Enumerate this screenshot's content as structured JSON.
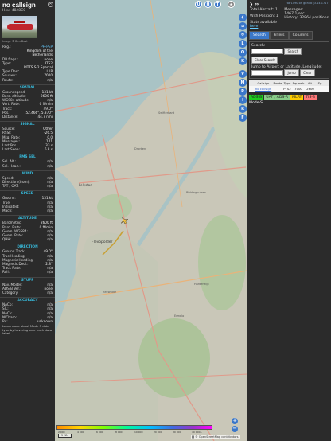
{
  "aircraft": {
    "callsign": "no callsign",
    "hex_label": "Hex:",
    "hex": "4848C0",
    "photo_credit": "Image © Ben Dost",
    "reg_label": "Reg.:",
    "reg": "PH-PEP",
    "country": "Kingdom of the Netherlands",
    "db_flags_label": "DB flags:",
    "db_flags": "none",
    "type_label": "Type:",
    "type": "PTS2",
    "type_full": "PITTS S-2 Special",
    "type_desc_label": "Type Desc.:",
    "type_desc": "L1P",
    "squawk_label": "Squawk:",
    "squawk": "7000",
    "route_label": "Route:",
    "route": "n/a"
  },
  "sections": {
    "spatial": "SPATIAL",
    "signal": "SIGNAL",
    "fms": "FMS SEL",
    "wind": "WIND",
    "speed": "SPEED",
    "altitude": "ALTITUDE",
    "direction": "DIRECTION",
    "stuff": "STUFF",
    "accuracy": "ACCURACY"
  },
  "spatial": [
    {
      "label": "Groundspeed:",
      "value": "131 kt"
    },
    {
      "label": "Baro. altitude:",
      "value": "2600 ft"
    },
    {
      "label": "WGS84 altitude:",
      "value": "n/a"
    },
    {
      "label": "Vert. Rate:",
      "value": "0 ft/min"
    },
    {
      "label": "Track:",
      "value": "49.0°"
    },
    {
      "label": "Pos.:",
      "value": "52.466°, 5.370°"
    },
    {
      "label": "Distance:",
      "value": "44.7 nmi"
    }
  ],
  "signal": [
    {
      "label": "Source:",
      "value": "Other"
    },
    {
      "label": "RSSI:",
      "value": "-26.5"
    },
    {
      "label": "Msg. Rate:",
      "value": "0.0"
    },
    {
      "label": "Messages:",
      "value": "141"
    },
    {
      "label": "Last Pos.:",
      "value": "33 s"
    },
    {
      "label": "Last Seen:",
      "value": "6.8 s"
    }
  ],
  "fms": [
    {
      "label": "Sel. Alt.:",
      "value": "n/a"
    },
    {
      "label": "Sel. Head.:",
      "value": "n/a"
    }
  ],
  "wind": [
    {
      "label": "Speed:",
      "value": "n/a"
    },
    {
      "label": "Direction (from):",
      "value": "n/a"
    },
    {
      "label": "TAT / OAT:",
      "value": "n/a"
    }
  ],
  "speed": [
    {
      "label": "Ground:",
      "value": "131 kt"
    },
    {
      "label": "True:",
      "value": "n/a"
    },
    {
      "label": "Indicated:",
      "value": "n/a"
    },
    {
      "label": "Mach:",
      "value": "n/a"
    }
  ],
  "altitude": [
    {
      "label": "Barometric:",
      "value": "2600 ft"
    },
    {
      "label": "Baro. Rate:",
      "value": "0 ft/min"
    },
    {
      "label": "Geom. WGS84:",
      "value": "n/a"
    },
    {
      "label": "Geom. Rate:",
      "value": "n/a"
    },
    {
      "label": "QNH:",
      "value": "n/a"
    }
  ],
  "direction": [
    {
      "label": "Ground Track:",
      "value": "49.0°"
    },
    {
      "label": "True Heading:",
      "value": "n/a"
    },
    {
      "label": "Magnetic Heading:",
      "value": "n/a"
    },
    {
      "label": "Magnetic Decl.:",
      "value": "2.8°"
    },
    {
      "label": "Track Rate:",
      "value": "n/a"
    },
    {
      "label": "Roll:",
      "value": "n/a"
    }
  ],
  "stuff": [
    {
      "label": "Nav. Modes:",
      "value": "n/a"
    },
    {
      "label": "ADS-B Ver.:",
      "value": "none"
    },
    {
      "label": "Category:",
      "value": "n/a"
    }
  ],
  "accuracy": [
    {
      "label": "NACp:",
      "value": "n/a"
    },
    {
      "label": "SIL:",
      "value": "n/a"
    },
    {
      "label": "NACv:",
      "value": "n/a"
    },
    {
      "label": "NICbaro:",
      "value": "n/a"
    },
    {
      "label": "Rc:",
      "value": "unknown"
    }
  ],
  "footnote": "Learn more about Mode S data type by hovering over each data label.",
  "map": {
    "top_buttons": [
      "U",
      "H",
      "T"
    ],
    "side_buttons": [
      "❮",
      "⌂",
      "↻",
      "L",
      "O",
      "K",
      "V",
      "M",
      "P",
      "I",
      "R",
      "F"
    ],
    "city_labels": [
      "Lelystad",
      "Dronten",
      "Swifterbant",
      "Biddinghuizen",
      "Zeewolde",
      "Ermelo",
      "Harderwijk"
    ],
    "aircraft_label": "Flevopolder",
    "zoom_in": "+",
    "zoom_out": "−",
    "scale_label": "5 NM",
    "altitude_scale": [
      "2 000",
      "4 000",
      "6 000",
      "8 000",
      "10 000",
      "20 000",
      "30 000",
      "40 000+"
    ],
    "attribution": "© OpenStreetMap contributors."
  },
  "right": {
    "version_link": "tar1090 on github (3.14.1717)",
    "total_label": "Total Aircraft:",
    "total": "1",
    "with_pos_label": "With Position:",
    "with_pos": "1",
    "msgs_label": "Messages:",
    "msgs": "1467.1/sec",
    "history_label": "History:",
    "history": "32864 positions",
    "stats_label": "Stats available",
    "stats_link": "here",
    "tabs": [
      "Search",
      "Filters",
      "Columns"
    ],
    "search_label": "Search:",
    "search_button": "Search",
    "clear_button": "Clear Search",
    "jump_label": "Jump to Airport or Latitude, Longitude:",
    "jump_button": "Jump",
    "clear2_button": "Clear",
    "table_headers": [
      "",
      "Callsign",
      "Route",
      "Type",
      "Squawk",
      "Alt.",
      "Sp"
    ],
    "table_row": [
      "",
      "no callsign",
      "",
      "PTS2",
      "7000",
      "2600",
      ""
    ],
    "sources": [
      {
        "label": "ADS-B",
        "color": "#1fcc1f"
      },
      {
        "label": "UAT / ADS-R",
        "color": "#88cc88"
      },
      {
        "label": "MLAT",
        "color": "#ffcc00"
      },
      {
        "label": "TIS-B",
        "color": "#ff7777"
      }
    ],
    "mode_s": "Mode-S"
  }
}
